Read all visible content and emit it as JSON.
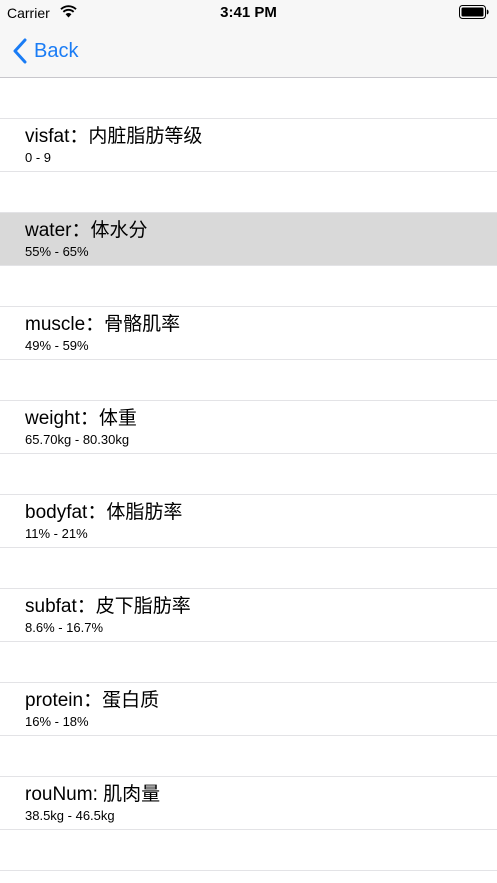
{
  "status_bar": {
    "carrier": "Carrier",
    "time": "3:41 PM",
    "wifi_icon": "wifi-icon",
    "battery_icon": "battery-full-icon"
  },
  "nav": {
    "back_label": "Back",
    "back_icon": "chevron-left-icon",
    "accent_color": "#1a7cf5"
  },
  "items": [
    {
      "title": "visfat：内脏脂肪等级",
      "range": "0 - 9",
      "selected": false
    },
    {
      "title": "water：体水分",
      "range": "55% - 65%",
      "selected": true
    },
    {
      "title": "muscle：骨骼肌率",
      "range": "49% - 59%",
      "selected": false
    },
    {
      "title": "weight：体重",
      "range": "65.70kg - 80.30kg",
      "selected": false
    },
    {
      "title": "bodyfat：体脂肪率",
      "range": "11% - 21%",
      "selected": false
    },
    {
      "title": "subfat：皮下脂肪率",
      "range": "8.6% - 16.7%",
      "selected": false
    },
    {
      "title": "protein：蛋白质",
      "range": "16% - 18%",
      "selected": false
    },
    {
      "title": "rouNum: 肌肉量",
      "range": "38.5kg - 46.5kg",
      "selected": false
    }
  ],
  "colors": {
    "selected_row": "#d9d9d9",
    "separator": "#e3e3e6",
    "bar_background": "#f7f7f7"
  }
}
